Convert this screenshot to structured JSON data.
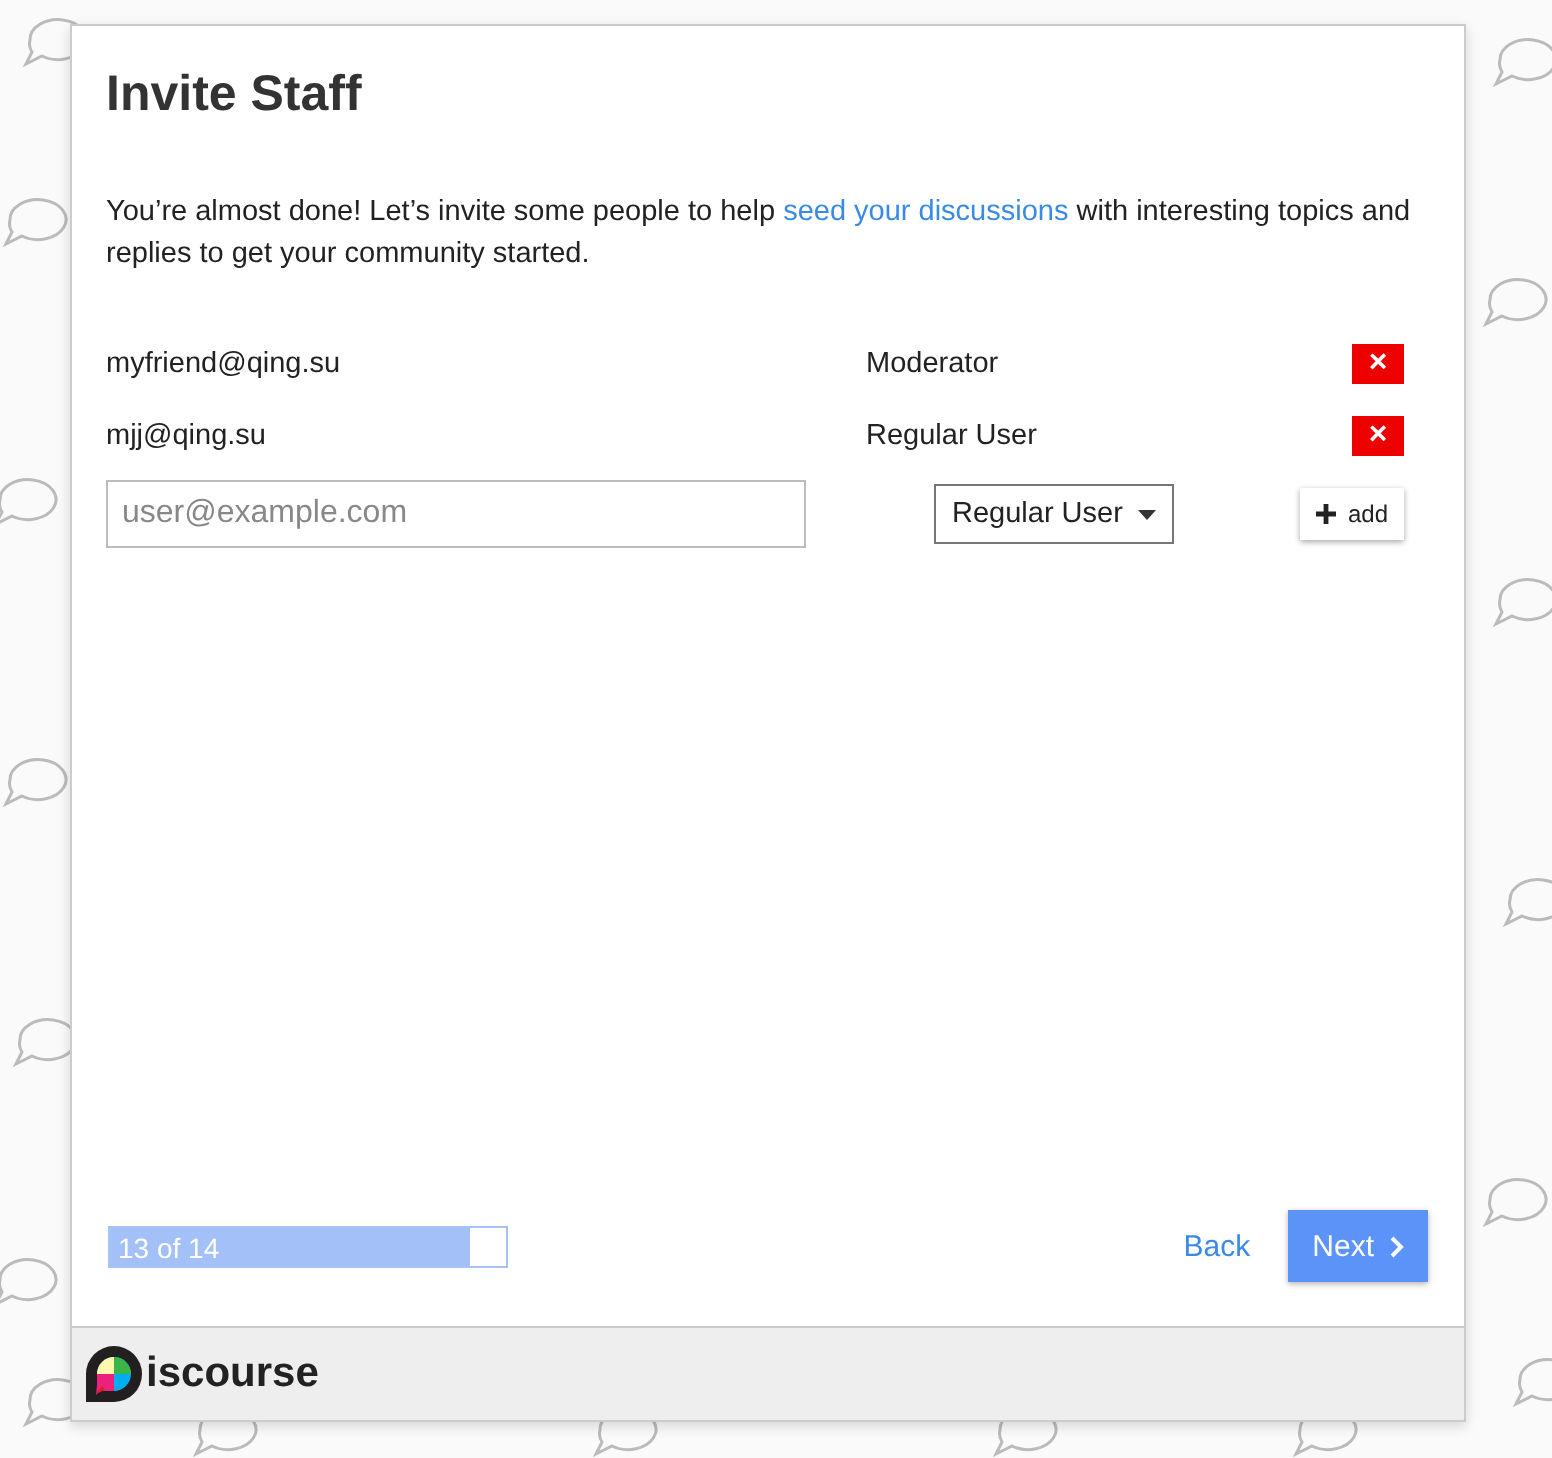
{
  "title": "Invite Staff",
  "intro": {
    "before": "You’re almost done! Let’s invite some people to help ",
    "link": "seed your discussions",
    "after": " with interesting topics and replies to get your community started."
  },
  "invites": [
    {
      "email": "myfriend@qing.su",
      "role": "Moderator",
      "remove": "×"
    },
    {
      "email": "mjj@qing.su",
      "role": "Regular User",
      "remove": "×"
    }
  ],
  "new_invite": {
    "placeholder": "user@example.com",
    "role": "Regular User",
    "add_button": "add"
  },
  "progress": {
    "label": "13 of 14",
    "level": 0.91
  },
  "back_button": "Back",
  "next_button": "Next",
  "footer": {
    "logo_text": "iscourse"
  }
}
